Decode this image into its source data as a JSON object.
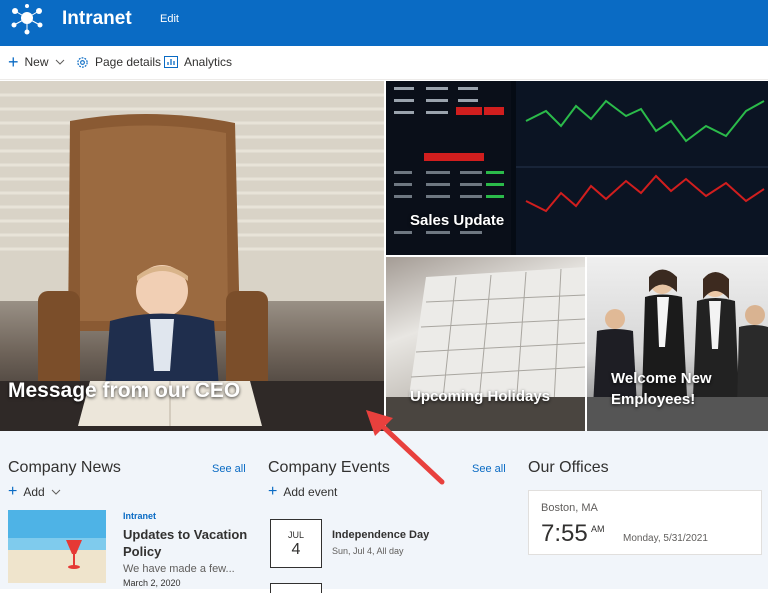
{
  "suite": {
    "site_title": "Intranet",
    "edit_label": "Edit"
  },
  "command_bar": {
    "new_label": "New",
    "page_details_label": "Page details",
    "analytics_label": "Analytics"
  },
  "hero": {
    "tiles": [
      {
        "caption": "Message from our CEO"
      },
      {
        "caption": "Sales Update"
      },
      {
        "caption": "Upcoming Holidays"
      },
      {
        "caption": "Welcome New Employees!"
      }
    ]
  },
  "news": {
    "title": "Company News",
    "see_all": "See all",
    "add_label": "Add",
    "item": {
      "source": "Intranet",
      "title": "Updates to Vacation Policy",
      "excerpt": "We have made a few...",
      "date": "March 2, 2020"
    }
  },
  "events": {
    "title": "Company Events",
    "see_all": "See all",
    "add_label": "Add event",
    "item": {
      "month": "JUL",
      "day": "4",
      "title": "Independence Day",
      "meta": "Sun, Jul 4, All day"
    }
  },
  "offices": {
    "title": "Our Offices",
    "card": {
      "city": "Boston, MA",
      "time": "7:55",
      "ampm": "AM",
      "date": "Monday, 5/31/2021"
    }
  },
  "colors": {
    "brand": "#0a6bc4",
    "annotation_arrow": "#e8403d"
  },
  "icons": [
    "app-logo-icon",
    "plus-icon",
    "chevron-down-icon",
    "gear-icon",
    "analytics-icon"
  ]
}
